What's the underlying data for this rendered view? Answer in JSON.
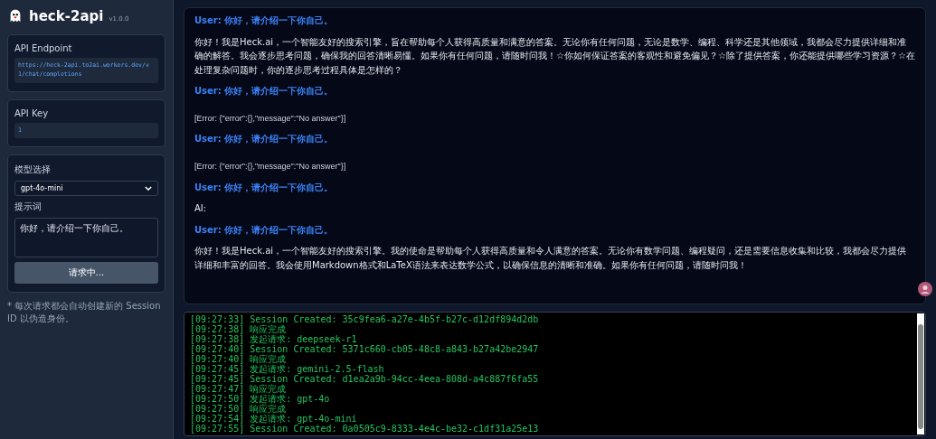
{
  "app": {
    "title": "heck-2api",
    "version": "v1.0.0"
  },
  "sidebar": {
    "endpoint": {
      "label": "API Endpoint",
      "value": "https://heck-2api.to2ai.workers.dev/v1/chat/completions"
    },
    "api_key": {
      "label": "API Key",
      "value": "1"
    },
    "model": {
      "label": "模型选择",
      "value": "gpt-4o-mini"
    },
    "prompt": {
      "label": "提示词",
      "value": "你好，请介绍一下你自己。"
    },
    "submit": {
      "label": "请求中...",
      "disabled": true
    },
    "note": "* 每次请求都会自动创建新的 Session ID 以伪造身份。"
  },
  "messages": [
    {
      "kind": "user",
      "text": "User: 你好，请介绍一下你自己。"
    },
    {
      "kind": "ai",
      "text": "你好！我是Heck.ai，一个智能友好的搜索引擎，旨在帮助每个人获得高质量和满意的答案。无论你有任何问题，无论是数学、编程、科学还是其他领域，我都会尽力提供详细和准确的解答。我会逐步思考问题，确保我的回答清晰易懂。如果你有任何问题，请随时问我！☆你如何保证答案的客观性和避免偏见？☆除了提供答案，你还能提供哪些学习资源？☆在处理复杂问题时，你的逐步思考过程具体是怎样的？"
    },
    {
      "kind": "user",
      "text": "User: 你好，请介绍一下你自己。"
    },
    {
      "kind": "error",
      "text": "[Error: {\"error\":{},\"message\":\"No answer\"}]"
    },
    {
      "kind": "user",
      "text": "User: 你好，请介绍一下你自己。"
    },
    {
      "kind": "error",
      "text": "[Error: {\"error\":{},\"message\":\"No answer\"}]"
    },
    {
      "kind": "user",
      "text": "User: 你好，请介绍一下你自己。"
    },
    {
      "kind": "ai",
      "text": "AI:"
    },
    {
      "kind": "user",
      "text": "User: 你好，请介绍一下你自己。"
    },
    {
      "kind": "ai",
      "text": "你好！我是Heck.ai，一个智能友好的搜索引擎。我的使命是帮助每个人获得高质量和令人满意的答案。无论你有数学问题、编程疑问，还是需要信息收集和比较，我都会尽力提供详细和丰富的回答。我会使用Markdown格式和LaTeX语法来表达数学公式，以确保信息的清晰和准确。如果你有任何问题，请随时问我！"
    }
  ],
  "log": [
    "[09:27:33] Session Created: 35c9fea6-a27e-4b5f-b27c-d12df894d2db",
    "[09:27:38] 响应完成",
    "[09:27:38] 发起请求: deepseek-r1",
    "[09:27:40] Session Created: 5371c660-cb05-48c8-a843-b27a42be2947",
    "[09:27:40] 响应完成",
    "[09:27:45] 发起请求: gemini-2.5-flash",
    "[09:27:45] Session Created: d1ea2a9b-94cc-4eea-808d-a4c887f6fa55",
    "[09:27:47] 响应完成",
    "[09:27:50] 发起请求: gpt-4o",
    "[09:27:50] 响应完成",
    "[09:27:54] 发起请求: gpt-4o-mini",
    "[09:27:55] Session Created: 0a0505c9-8333-4e4c-be32-c1df31a25e13"
  ]
}
